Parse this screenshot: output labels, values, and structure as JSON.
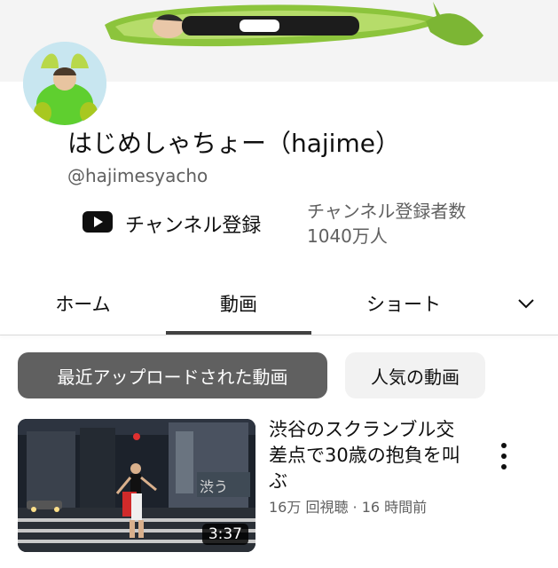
{
  "channel": {
    "name": "はじめしゃちょー（hajime）",
    "handle": "@hajimesyacho",
    "subscribe_label": "チャンネル登録",
    "subscriber_label": "チャンネル登録者数",
    "subscriber_count": "1040万人"
  },
  "tabs": [
    {
      "label": "ホーム"
    },
    {
      "label": "動画"
    },
    {
      "label": "ショート"
    }
  ],
  "filters": {
    "recent": "最近アップロードされた動画",
    "popular": "人気の動画"
  },
  "video": {
    "title": "渋谷のスクランブル交差点で30歳の抱負を叫ぶ",
    "meta": "16万 回視聴 · 16 時間前",
    "duration": "3:37"
  },
  "colors": {
    "active_chip": "#606060",
    "inactive_chip": "#f2f2f2",
    "youtube_icon": "#0f0f0f"
  }
}
